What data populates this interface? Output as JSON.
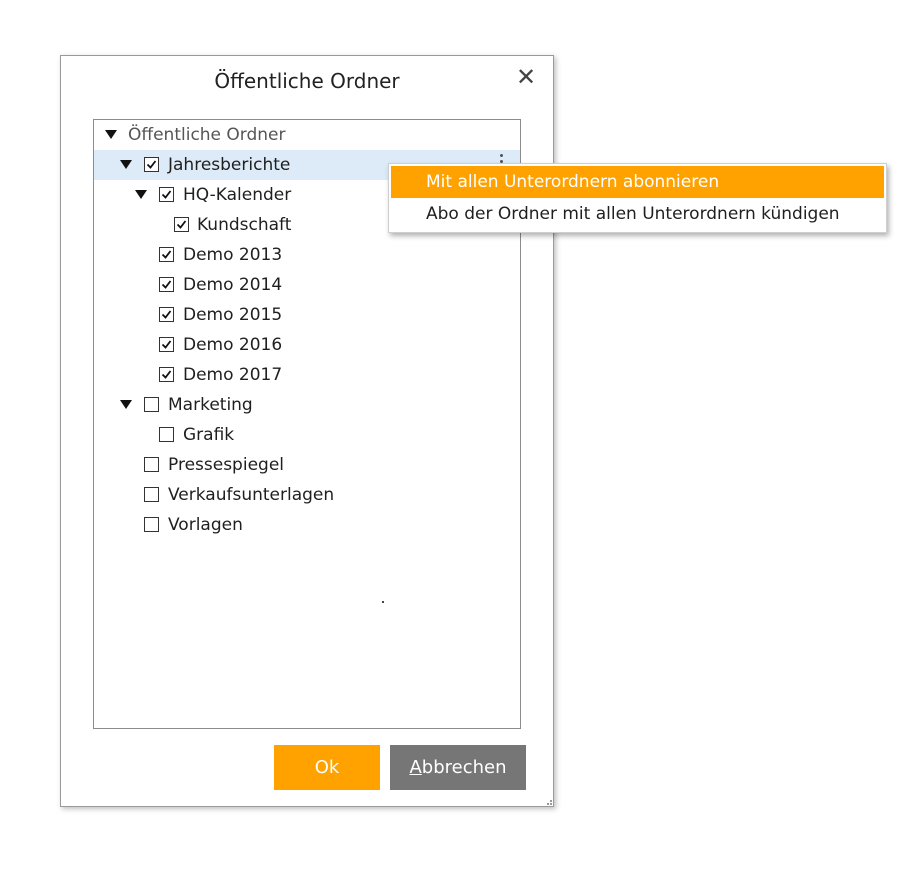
{
  "dialog": {
    "title": "Öffentliche Ordner",
    "close_icon": "close-icon"
  },
  "tree": {
    "root": {
      "label": "Öffentliche Ordner",
      "expanded": true
    },
    "items": [
      {
        "label": "Jahresberichte",
        "checked": true,
        "expanded": true,
        "selected": true
      },
      {
        "label": "HQ-Kalender",
        "checked": true,
        "expanded": true
      },
      {
        "label": "Kundschaft",
        "checked": true
      },
      {
        "label": "Demo 2013",
        "checked": true
      },
      {
        "label": "Demo 2014",
        "checked": true
      },
      {
        "label": "Demo 2015",
        "checked": true
      },
      {
        "label": "Demo 2016",
        "checked": true
      },
      {
        "label": "Demo 2017",
        "checked": true
      },
      {
        "label": "Marketing",
        "checked": false,
        "expanded": true
      },
      {
        "label": "Grafik",
        "checked": false
      },
      {
        "label": "Pressespiegel",
        "checked": false
      },
      {
        "label": "Verkaufsunterlagen",
        "checked": false
      },
      {
        "label": "Vorlagen",
        "checked": false
      }
    ]
  },
  "buttons": {
    "ok": "Ok",
    "cancel": "Abbrechen"
  },
  "context_menu": {
    "items": [
      {
        "label": "Mit allen Unterordnern abonnieren",
        "highlighted": true
      },
      {
        "label": "Abo der Ordner mit allen Unterordnern kündigen",
        "highlighted": false
      }
    ]
  },
  "colors": {
    "accent": "#ffa200",
    "cancel_button": "#767676",
    "selected_row": "#ddeaf8"
  }
}
